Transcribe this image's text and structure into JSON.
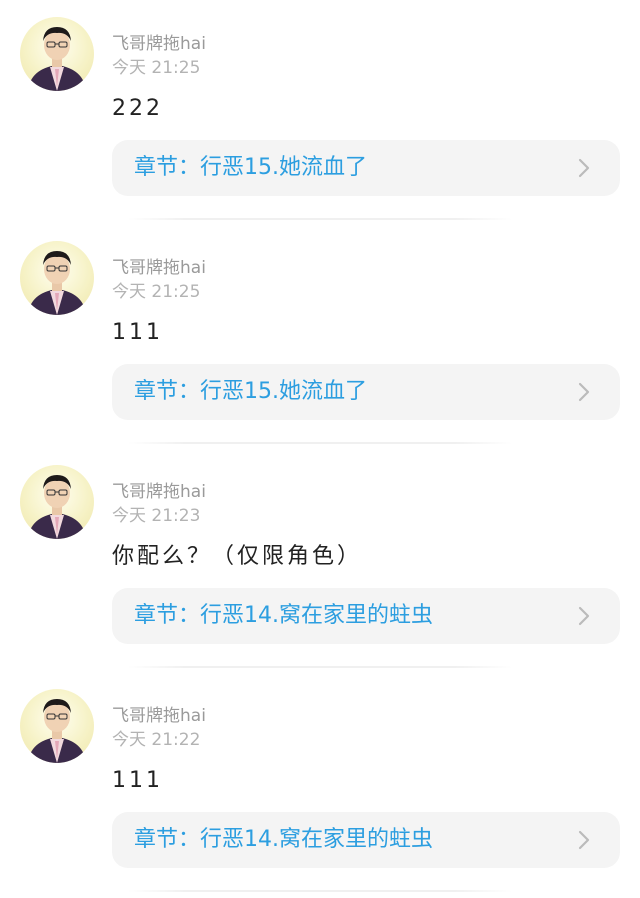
{
  "comments": [
    {
      "username": "飞哥牌拖hai",
      "timestamp": "今天 21:25",
      "text": "222",
      "chapter": "章节：行恶15.她流血了"
    },
    {
      "username": "飞哥牌拖hai",
      "timestamp": "今天 21:25",
      "text": "111",
      "chapter": "章节：行恶15.她流血了"
    },
    {
      "username": "飞哥牌拖hai",
      "timestamp": "今天 21:23",
      "text": "你配么？（仅限角色）",
      "chapter": "章节：行恶14.窝在家里的蛀虫"
    },
    {
      "username": "飞哥牌拖hai",
      "timestamp": "今天 21:22",
      "text": "111",
      "chapter": "章节：行恶14.窝在家里的蛀虫"
    }
  ],
  "icons": {
    "avatar": "user-avatar",
    "chevron": "chevron-right-icon"
  },
  "colors": {
    "link": "#2c9ee0",
    "username": "#9a9a9a",
    "timestamp": "#b3b3b3",
    "card_background": "#f4f4f4"
  }
}
